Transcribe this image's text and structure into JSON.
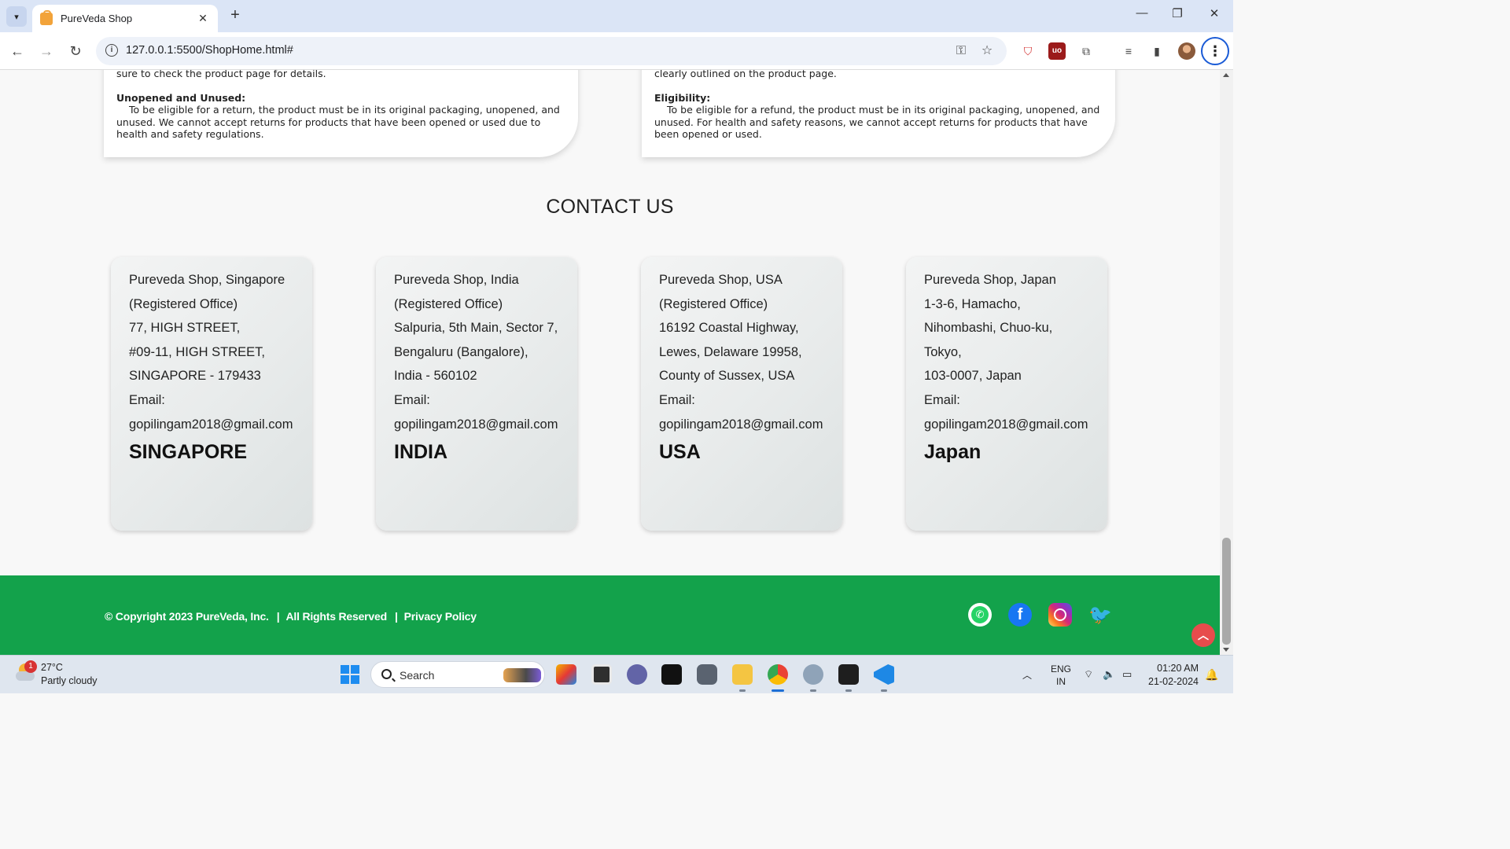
{
  "browser": {
    "tab_title": "PureVeda Shop",
    "url": "127.0.0.1:5500/ShopHome.html#"
  },
  "policies": [
    {
      "top_text": "sure to check the product page for details.",
      "heading": "Unopened and Unused:",
      "body": "To be eligible for a return, the product must be in its original packaging, unopened, and unused. We cannot accept returns for products that have been opened or used due to health and safety regulations."
    },
    {
      "top_text": "clearly outlined on the product page.",
      "heading": "Eligibility:",
      "body": "To be eligible for a refund, the product must be in its original packaging, unopened, and unused. For health and safety reasons, we cannot accept returns for products that have been opened or used."
    }
  ],
  "contact": {
    "title": "CONTACT US",
    "offices": [
      {
        "lines": [
          "Pureveda Shop, Singapore",
          "(Registered Office)",
          "77, HIGH STREET,",
          "#09-11, HIGH STREET,",
          "SINGAPORE - 179433",
          "Email:",
          "gopilingam2018@gmail.com"
        ],
        "country": "SINGAPORE"
      },
      {
        "lines": [
          "Pureveda Shop, India",
          "(Registered Office)",
          "Salpuria, 5th Main, Sector 7,",
          "Bengaluru (Bangalore),",
          "India - 560102",
          "Email:",
          "gopilingam2018@gmail.com"
        ],
        "country": "INDIA"
      },
      {
        "lines": [
          "Pureveda Shop, USA",
          "(Registered Office)",
          "16192 Coastal Highway,",
          "Lewes, Delaware 19958,",
          "County of Sussex, USA",
          "Email:",
          "gopilingam2018@gmail.com"
        ],
        "country": "USA"
      },
      {
        "lines": [
          "Pureveda Shop, Japan",
          "1-3-6, Hamacho,",
          "Nihombashi, Chuo-ku,",
          "Tokyo,",
          "103-0007, Japan",
          "Email:",
          "gopilingam2018@gmail.com"
        ],
        "country": "Japan"
      }
    ]
  },
  "footer": {
    "copyright": "© Copyright 2023 PureVeda, Inc.",
    "separator": "|",
    "rights": "All Rights Reserved",
    "privacy": "Privacy Policy",
    "social_icons": [
      "whatsapp-icon",
      "facebook-icon",
      "instagram-icon",
      "twitter-icon"
    ],
    "accent_color": "#13a24b"
  },
  "taskbar": {
    "weather_badge": "1",
    "temperature": "27°C",
    "condition": "Partly cloudy",
    "search_placeholder": "Search",
    "lang_line1": "ENG",
    "lang_line2": "IN",
    "time": "01:20 AM",
    "date": "21-02-2024"
  }
}
